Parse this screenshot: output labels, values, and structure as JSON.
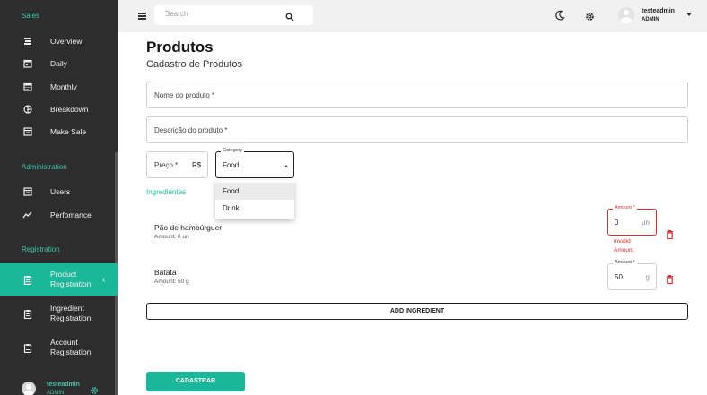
{
  "sidebar": {
    "sections": {
      "sales": "Sales",
      "administration": "Administration",
      "registration": "Registration"
    },
    "items": {
      "overview": "Overview",
      "daily": "Daily",
      "monthly": "Monthly",
      "breakdown": "Breakdown",
      "make_sale": "Make Sale",
      "users": "Users",
      "performance": "Perfomance",
      "product_registration": "Product Registration",
      "ingredient_registration": "Ingredient Registration",
      "account_registration": "Account Registration"
    },
    "user": {
      "name": "testeadmin",
      "role": "ADMIN"
    }
  },
  "topbar": {
    "search_placeholder": "Search",
    "user_name": "testeadmin",
    "user_role": "ADMIN"
  },
  "page": {
    "title": "Produtos",
    "subtitle": "Cadastro de Produtos"
  },
  "form": {
    "name_placeholder": "Nome do produto *",
    "description_placeholder": "Descrição do produto *",
    "price_label": "Preço *",
    "price_prefix": "R$",
    "category_label": "Category",
    "category_value": "Food",
    "category_options": [
      "Food",
      "Drink"
    ],
    "ingredients_heading": "Ingredientes",
    "ingredients": [
      {
        "name": "Pão de hambúrguer",
        "amount_text": "Amount: 0 un",
        "amount_label": "Amount *",
        "amount_value": "0",
        "unit": "un",
        "error": "Invalid Amount"
      },
      {
        "name": "Batata",
        "amount_text": "Amount: 50 g",
        "amount_label": "Amount *",
        "amount_value": "50",
        "unit": "g"
      }
    ],
    "add_ingredient_label": "ADD INGREDIENT",
    "submit_label": "CADASTRAR"
  },
  "colors": {
    "accent": "#1bb79b",
    "sidebar_bg": "#2d2d2d",
    "error": "#d32f2f"
  }
}
